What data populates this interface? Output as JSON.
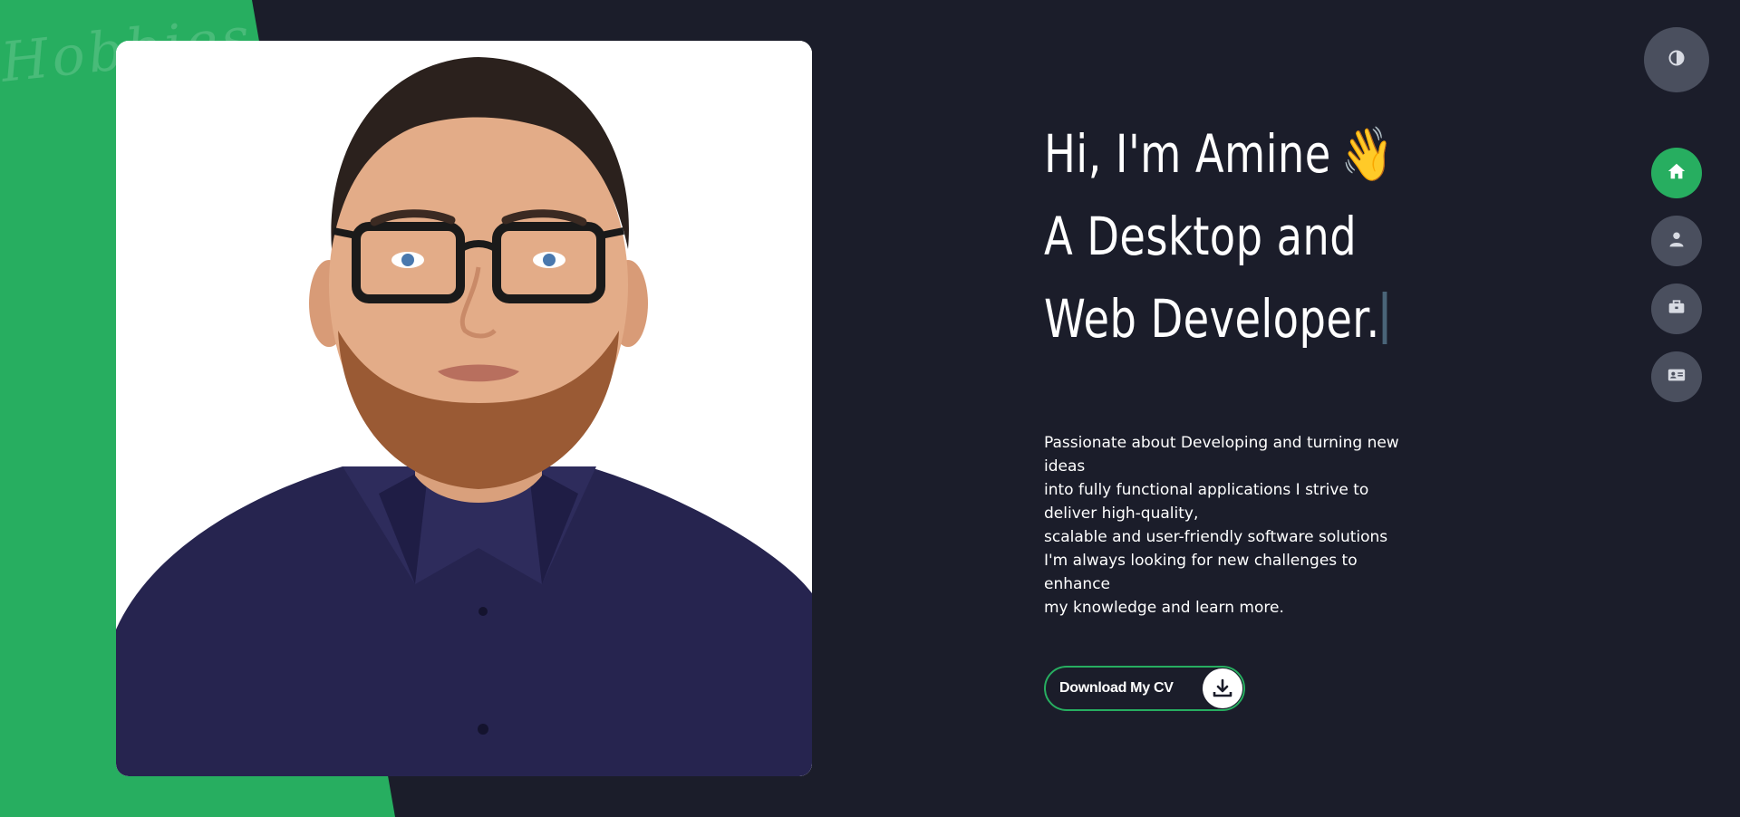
{
  "background_signature": "Hobbies Amine",
  "hero": {
    "greeting": "Hi, I'm Amine",
    "wave_emoji": "👋",
    "role_line_1": "A Desktop and",
    "role_line_2": "Web Developer."
  },
  "bio": {
    "line_1": "Passionate about Developing and turning new ideas",
    "line_2": "into fully functional applications I strive to deliver high-quality,",
    "line_3": "scalable and user-friendly software solutions",
    "line_4": "I'm always looking for new challenges to enhance",
    "line_5": "my knowledge and learn more."
  },
  "cta": {
    "label": "Download My CV",
    "icon": "download-icon"
  },
  "theme_toggle": {
    "icon": "contrast-icon"
  },
  "nav": {
    "items": [
      {
        "icon": "home-icon",
        "active": true
      },
      {
        "icon": "user-icon",
        "active": false
      },
      {
        "icon": "briefcase-icon",
        "active": false
      },
      {
        "icon": "id-card-icon",
        "active": false
      }
    ]
  },
  "colors": {
    "background": "#1b1d2a",
    "accent": "#27ae60",
    "nav_button": "#4a4f5e",
    "photo_shirt": "#26244f"
  }
}
